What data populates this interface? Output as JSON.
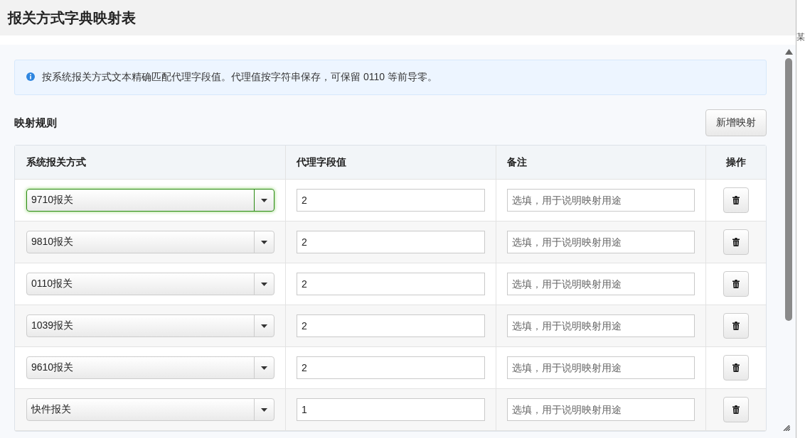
{
  "dialog": {
    "title": "报关方式字典映射表"
  },
  "background_text": "某",
  "info": {
    "text": "按系统报关方式文本精确匹配代理字段值。代理值按字符串保存，可保留 0110 等前导零。"
  },
  "section": {
    "title": "映射规则",
    "add_button": "新增映射"
  },
  "table": {
    "columns": [
      "系统报关方式",
      "代理字段值",
      "备注",
      "操作"
    ],
    "rows": [
      {
        "method": "9710报关",
        "focused": true,
        "value": "2",
        "note_placeholder": "选填，用于说明映射用途"
      },
      {
        "method": "9810报关",
        "focused": false,
        "value": "2",
        "note_placeholder": "选填，用于说明映射用途"
      },
      {
        "method": "0110报关",
        "focused": false,
        "value": "2",
        "note_placeholder": "选填，用于说明映射用途"
      },
      {
        "method": "1039报关",
        "focused": false,
        "value": "2",
        "note_placeholder": "选填，用于说明映射用途"
      },
      {
        "method": "9610报关",
        "focused": false,
        "value": "2",
        "note_placeholder": "选填，用于说明映射用途"
      },
      {
        "method": "快件报关",
        "focused": false,
        "value": "1",
        "note_placeholder": "选填，用于说明映射用途"
      }
    ]
  }
}
